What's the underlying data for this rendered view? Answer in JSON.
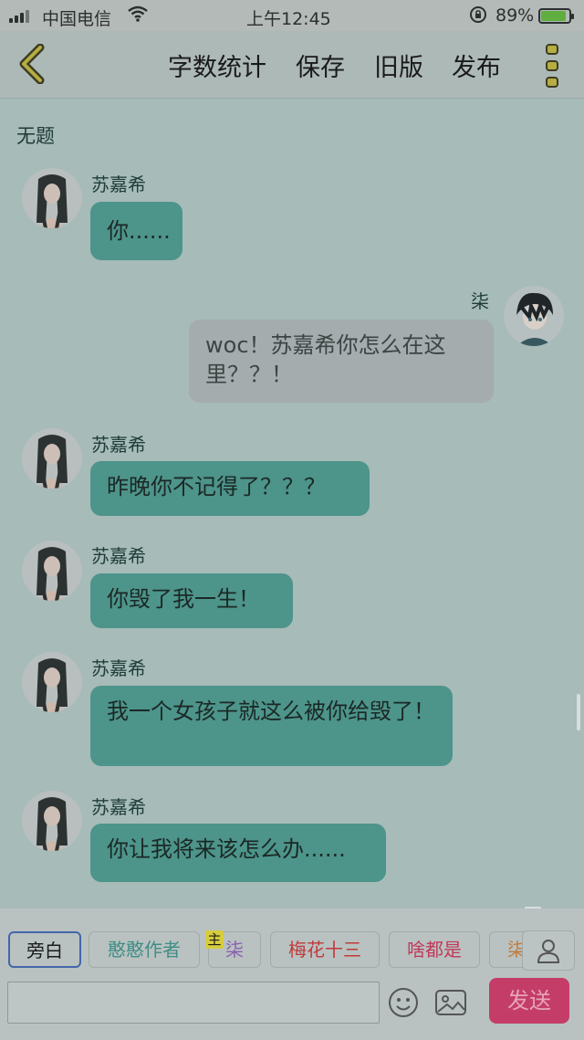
{
  "status_bar": {
    "carrier": "中国电信",
    "time": "上午12:45",
    "battery_pct": "89%",
    "battery_level": 0.89
  },
  "toolbar": {
    "word_count": "字数统计",
    "save": "保存",
    "old_version": "旧版",
    "publish": "发布"
  },
  "chat": {
    "title": "无题",
    "messages": [
      {
        "side": "left",
        "name": "苏嘉希",
        "text": "你......"
      },
      {
        "side": "right",
        "name": "柒",
        "text": "woc！苏嘉希你怎么在这里？？！"
      },
      {
        "side": "left",
        "name": "苏嘉希",
        "text": "昨晚你不记得了？？？"
      },
      {
        "side": "left",
        "name": "苏嘉希",
        "text": "你毁了我一生！"
      },
      {
        "side": "left",
        "name": "苏嘉希",
        "text": "我一个女孩子就这么被你给毁了！"
      },
      {
        "side": "left",
        "name": "苏嘉希",
        "text": "你让我将来该怎么办......"
      }
    ]
  },
  "roles": {
    "crown_label": "主",
    "items": [
      {
        "label": "旁白",
        "color": "#1b1b1b"
      },
      {
        "label": "憨憨作者",
        "color": "#3f8d84"
      },
      {
        "label": "柒",
        "color": "#8a5fb0"
      },
      {
        "label": "梅花十三",
        "color": "#c0393b"
      },
      {
        "label": "啥都是",
        "color": "#c0395a"
      },
      {
        "label": "柒",
        "color": "#c07a3a"
      }
    ]
  },
  "composer": {
    "placeholder": "",
    "send": "发送"
  },
  "colors": {
    "bubble_left": "#4d948a",
    "bubble_right": "#a4acad",
    "send": "#c43d69"
  }
}
